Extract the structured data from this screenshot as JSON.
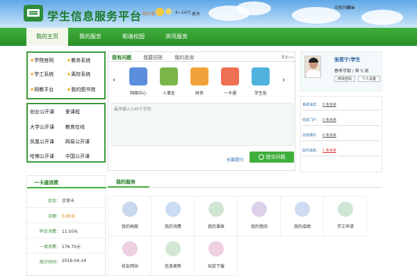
{
  "header": {
    "site_title": "学生信息服务平台",
    "city": "哈尔滨",
    "temperature": "4~14℃",
    "more": "更多",
    "toplinks": "功能列表 ▾",
    "logout": "退出"
  },
  "nav": [
    "我的主页",
    "我的服务",
    "和谐校园",
    "资讯服务"
  ],
  "quick_links": [
    "学院官网",
    "教务系统",
    "学工系统",
    "离校系统",
    "网教平台",
    "我的图书馆"
  ],
  "courses": [
    "创业公开课",
    "爱课程",
    "大学公开课",
    "教育在线",
    "凤凰公开课",
    "网易公开课",
    "哈佛公开课",
    "中国公开课"
  ],
  "center": {
    "tabs": [
      "我有问题",
      "我要回答",
      "我的咨询"
    ],
    "more": "更多>>",
    "shortcuts": [
      "网络中心",
      "人事处",
      "财务",
      "一卡通",
      "学生处"
    ],
    "textarea_placeholder": "最多输入140个字符",
    "ask_link": "长篇提问",
    "submit_label": "提交问题"
  },
  "profile": {
    "name": "张君宁/学生",
    "term": "春季学期 / 第 5 周",
    "btn_password": "修改密码",
    "btn_settings": "个人设置"
  },
  "messages": [
    {
      "label": "系统消息：",
      "value": "0 条未读"
    },
    {
      "label": "信息门户：",
      "value": "0 条未读"
    },
    {
      "label": "在线排队：",
      "value": "0 条未读"
    },
    {
      "label": "站内消息：",
      "value": "1 条未读"
    }
  ],
  "card": {
    "title": "一卡通消费",
    "rows": [
      {
        "k": "状态：",
        "v": "正常卡"
      },
      {
        "k": "余额：",
        "v": "0.80元"
      },
      {
        "k": "昨日消费：",
        "v": "11.50元"
      },
      {
        "k": "一周消费：",
        "v": "176.70元"
      },
      {
        "k": "统计时间：",
        "v": "2016-04-14"
      }
    ]
  },
  "services": {
    "title": "我的服务",
    "items": [
      "我的档案",
      "我的消费",
      "我的课表",
      "我的借阅",
      "我的成绩",
      "学工申请",
      "校友网站",
      "信息更新",
      "玩奖下载"
    ]
  },
  "colors": {
    "brand_green": "#3fae3a",
    "link_blue": "#2a6ab0",
    "alert_red": "#e03030"
  }
}
